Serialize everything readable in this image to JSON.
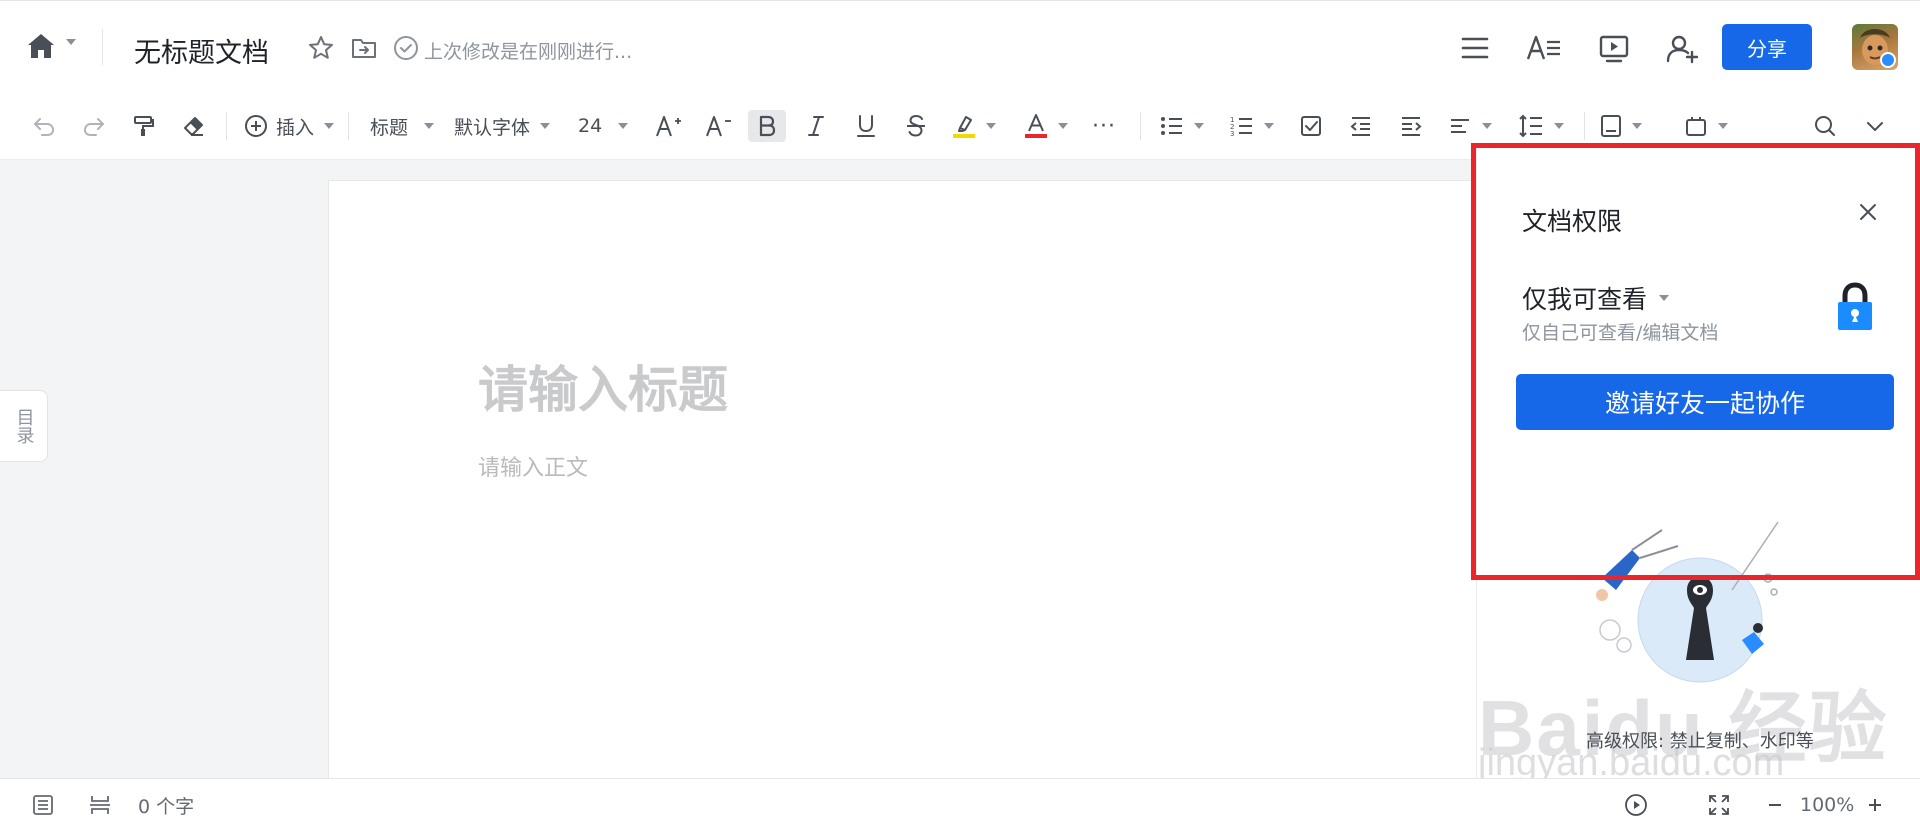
{
  "header": {
    "doc_title": "无标题文档",
    "saved_status": "上次修改是在刚刚进行...",
    "share_label": "分享",
    "icons": [
      "home-icon",
      "star-icon",
      "move-to-folder-icon",
      "saved-check-icon",
      "menu-icon",
      "text-format-icon",
      "present-icon",
      "add-collaborator-icon"
    ]
  },
  "toolbar": {
    "insert_label": "插入",
    "style_label": "标题",
    "font_label": "默认字体",
    "font_size": "24",
    "more_label": "···"
  },
  "editor": {
    "toc_tab": "目录",
    "title_placeholder": "请输入标题",
    "body_placeholder": "请输入正文"
  },
  "permission_panel": {
    "title": "文档权限",
    "level": "仅我可查看",
    "level_desc": "仅自己可查看/编辑文档",
    "invite_button": "邀请好友一起协作",
    "advanced_text": "高级权限: 禁止复制、水印等"
  },
  "watermark": {
    "line1": "Baidu 经验",
    "line2": "jingyan.baidu.com"
  },
  "statusbar": {
    "word_count": "0 个字",
    "zoom": "100%"
  },
  "colors": {
    "accent": "#1668e8",
    "highlight_border": "#e8262c"
  }
}
